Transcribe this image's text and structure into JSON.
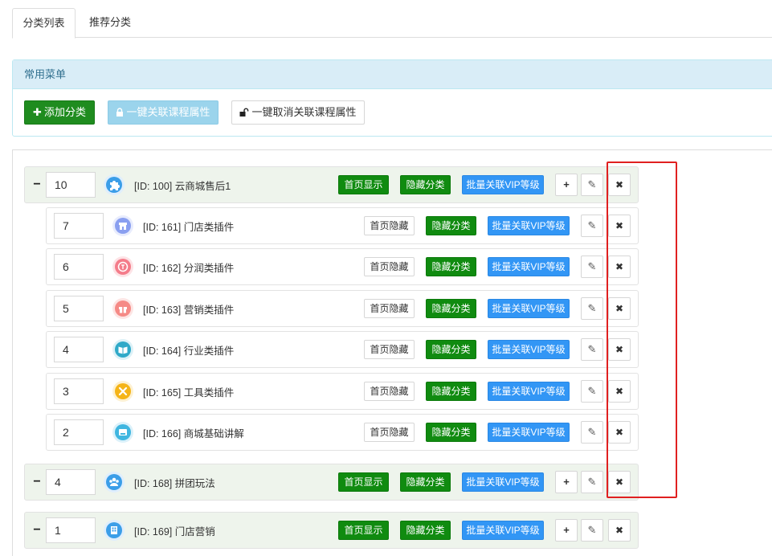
{
  "tabs": [
    {
      "label": "分类列表",
      "active": true
    },
    {
      "label": "推荐分类",
      "active": false
    }
  ],
  "common_menu": {
    "title": "常用菜单",
    "add_label": "添加分类",
    "link_label": "一键关联课程属性",
    "unlink_label": "一键取消关联课程属性"
  },
  "actions": {
    "home_show": "首页显示",
    "home_hide": "首页隐藏",
    "hide_category": "隐藏分类",
    "batch_vip": "批量关联VIP等级",
    "add_symbol": "+",
    "edit_symbol": "✎",
    "delete_symbol": "✖",
    "collapse_symbol": "−"
  },
  "categories": [
    {
      "sort": "10",
      "label": "[ID: 100] 云商城售后1",
      "level": "parent",
      "home": "首页显示",
      "icon": "puzzle-icon",
      "color": "#3b9ee8"
    },
    {
      "sort": "7",
      "label": "[ID: 161] 门店类插件",
      "level": "child",
      "home": "首页隐藏",
      "icon": "store-icon",
      "color": "#8a9ff0"
    },
    {
      "sort": "6",
      "label": "[ID: 162] 分润类插件",
      "level": "child",
      "home": "首页隐藏",
      "icon": "profit-icon",
      "color": "#f47c8a"
    },
    {
      "sort": "5",
      "label": "[ID: 163] 营销类插件",
      "level": "child",
      "home": "首页隐藏",
      "icon": "gift-icon",
      "color": "#f58a86"
    },
    {
      "sort": "4",
      "label": "[ID: 164] 行业类插件",
      "level": "child",
      "home": "首页隐藏",
      "icon": "book-icon",
      "color": "#2fa9c8"
    },
    {
      "sort": "3",
      "label": "[ID: 165] 工具类插件",
      "level": "child",
      "home": "首页隐藏",
      "icon": "tools-icon",
      "color": "#f5b418"
    },
    {
      "sort": "2",
      "label": "[ID: 166] 商城基础讲解",
      "level": "child",
      "home": "首页隐藏",
      "icon": "shop-icon",
      "color": "#3fb6e0"
    },
    {
      "sort": "4",
      "label": "[ID: 168] 拼团玩法",
      "level": "parent",
      "home": "首页显示",
      "icon": "group-icon",
      "color": "#3b9ee8"
    },
    {
      "sort": "1",
      "label": "[ID: 169] 门店营销",
      "level": "parent",
      "home": "首页显示",
      "icon": "building-icon",
      "color": "#3b9ee8"
    }
  ],
  "colors": {
    "highlight_border": "#e02020",
    "green": "#108b10",
    "blue": "#3296f5"
  }
}
